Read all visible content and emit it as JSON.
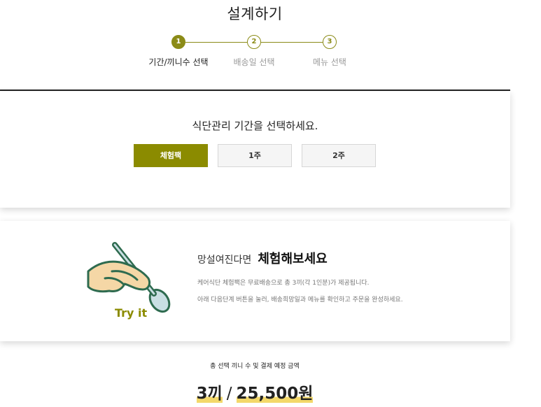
{
  "page": {
    "title": "설계하기"
  },
  "steps": [
    {
      "number": "1",
      "label": "기간/끼니수 선택",
      "active": true
    },
    {
      "number": "2",
      "label": "배송일 선택",
      "active": false
    },
    {
      "number": "3",
      "label": "메뉴 선택",
      "active": false
    }
  ],
  "period": {
    "title": "식단관리 기간을 선택하세요.",
    "options": [
      "체험팩",
      "1주",
      "2주"
    ],
    "selected": "체험팩"
  },
  "trial": {
    "heading_prefix": "망설여진다면",
    "heading_strong": "체험해보세요",
    "desc_1": "케어식단 체험팩은 무료배송으로 총 3끼(각 1인분)가 제공됩니다.",
    "desc_2": "아래 다음단계 버튼을 눌러, 배송희망일과 메뉴를 확인하고 주문을 완성하세요.",
    "badge": "Try it",
    "icon": "spoon-hand-icon"
  },
  "summary": {
    "label": "총 선택 끼니 수 및 결제 예정 금액",
    "meals": "3끼",
    "separator": "/",
    "price": "25,500원"
  },
  "colors": {
    "accent": "#8b8b00",
    "highlight": "#f3d86a",
    "illustration_stroke": "#2e6b4f",
    "hand_fill": "#f5d7a6",
    "spoon_fill": "#c9dfe3"
  }
}
